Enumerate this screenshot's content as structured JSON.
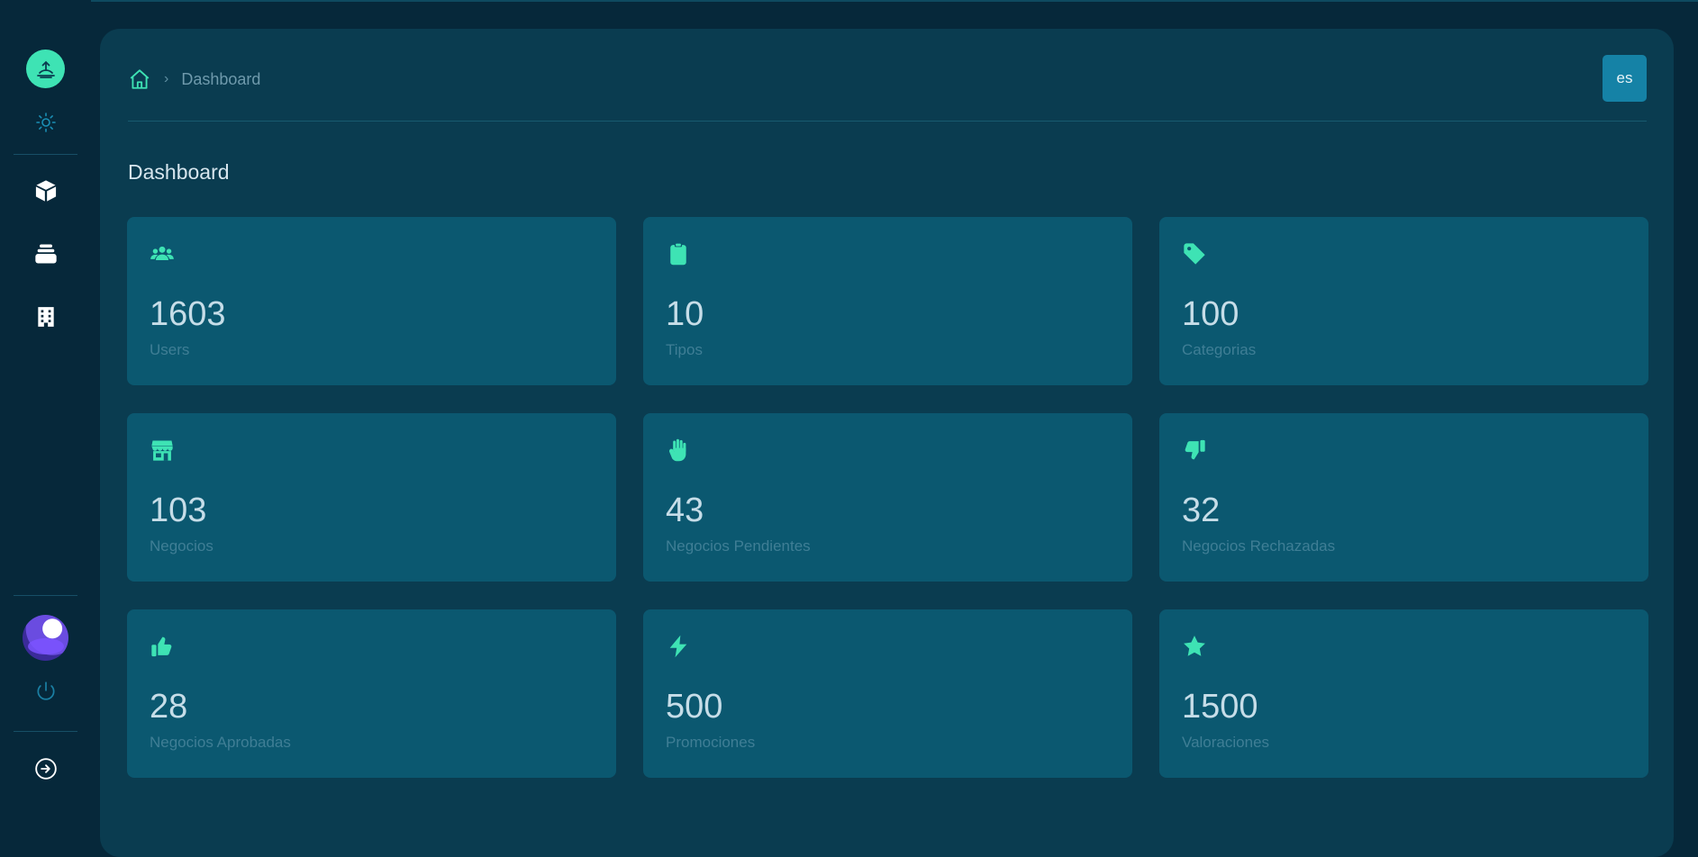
{
  "sidebar": {
    "nav_icons": [
      "box-icon",
      "layers-icon",
      "building-icon"
    ],
    "accent": "#3ee3b4"
  },
  "header": {
    "breadcrumb": {
      "current": "Dashboard"
    },
    "language": "es"
  },
  "page": {
    "title": "Dashboard"
  },
  "cards": [
    {
      "icon": "users-icon",
      "value": "1603",
      "label": "Users"
    },
    {
      "icon": "clipboard-icon",
      "value": "10",
      "label": "Tipos"
    },
    {
      "icon": "tag-icon",
      "value": "100",
      "label": "Categorias"
    },
    {
      "icon": "store-icon",
      "value": "103",
      "label": "Negocios"
    },
    {
      "icon": "hand-icon",
      "value": "43",
      "label": "Negocios Pendientes"
    },
    {
      "icon": "thumbs-down-icon",
      "value": "32",
      "label": "Negocios Rechazadas"
    },
    {
      "icon": "thumbs-up-icon",
      "value": "28",
      "label": "Negocios Aprobadas"
    },
    {
      "icon": "bolt-icon",
      "value": "500",
      "label": "Promociones"
    },
    {
      "icon": "star-icon",
      "value": "1500",
      "label": "Valoraciones"
    }
  ]
}
